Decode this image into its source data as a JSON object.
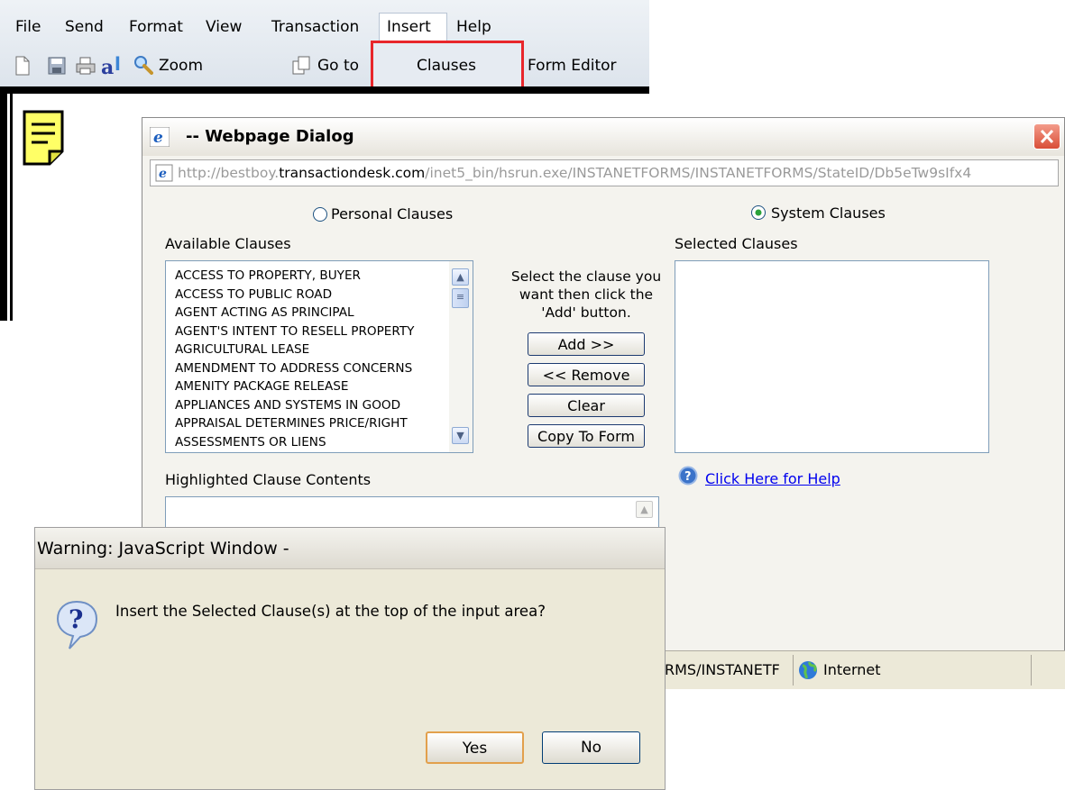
{
  "menu": {
    "file": "File",
    "send": "Send",
    "format": "Format",
    "view": "View",
    "transaction": "Transaction",
    "insert": "Insert",
    "help": "Help"
  },
  "toolbar": {
    "zoom": "Zoom",
    "go_to": "Go to",
    "clauses": "Clauses",
    "form_editor": "Form Editor"
  },
  "web_dialog": {
    "title": "-- Webpage Dialog",
    "url_prefix": "http://bestboy.",
    "url_domain": "transactiondesk.com",
    "url_path": "/inet5_bin/hsrun.exe/INSTANETFORMS/INSTANETFORMS/StateID/Db5eTw9sIfx4",
    "personal_clauses": "Personal Clauses",
    "system_clauses": "System Clauses",
    "selected_radio": "System Clauses",
    "available_label": "Available Clauses",
    "selected_label": "Selected Clauses",
    "instructions": [
      "Select the clause you",
      "want then click the",
      "'Add' button."
    ],
    "buttons": {
      "add": "Add >>",
      "remove": "<< Remove",
      "clear": "Clear",
      "copy": "Copy To Form"
    },
    "available_clauses": [
      "ACCESS TO PROPERTY, BUYER",
      "ACCESS TO PUBLIC ROAD",
      "AGENT ACTING AS PRINCIPAL",
      "AGENT'S INTENT TO RESELL PROPERTY",
      "AGRICULTURAL LEASE",
      "AMENDMENT TO ADDRESS CONCERNS",
      "AMENITY PACKAGE RELEASE",
      "APPLIANCES AND SYSTEMS IN GOOD",
      "APPRAISAL DETERMINES PRICE/RIGHT",
      "ASSESSMENTS OR LIENS"
    ],
    "help_link": "Click Here for Help",
    "highlighted_label": "Highlighted Clause Contents",
    "status_text": "RMS/INSTANETF",
    "status_zone": "Internet"
  },
  "warning": {
    "title": "Warning: JavaScript Window -",
    "message": "Insert the Selected Clause(s) at the top of the input area?",
    "yes": "Yes",
    "no": "No"
  },
  "colors": {
    "highlight_box": "#e8262b",
    "link": "#0000ee",
    "close_button": "#e8533f",
    "note_icon": "#ffff66"
  }
}
